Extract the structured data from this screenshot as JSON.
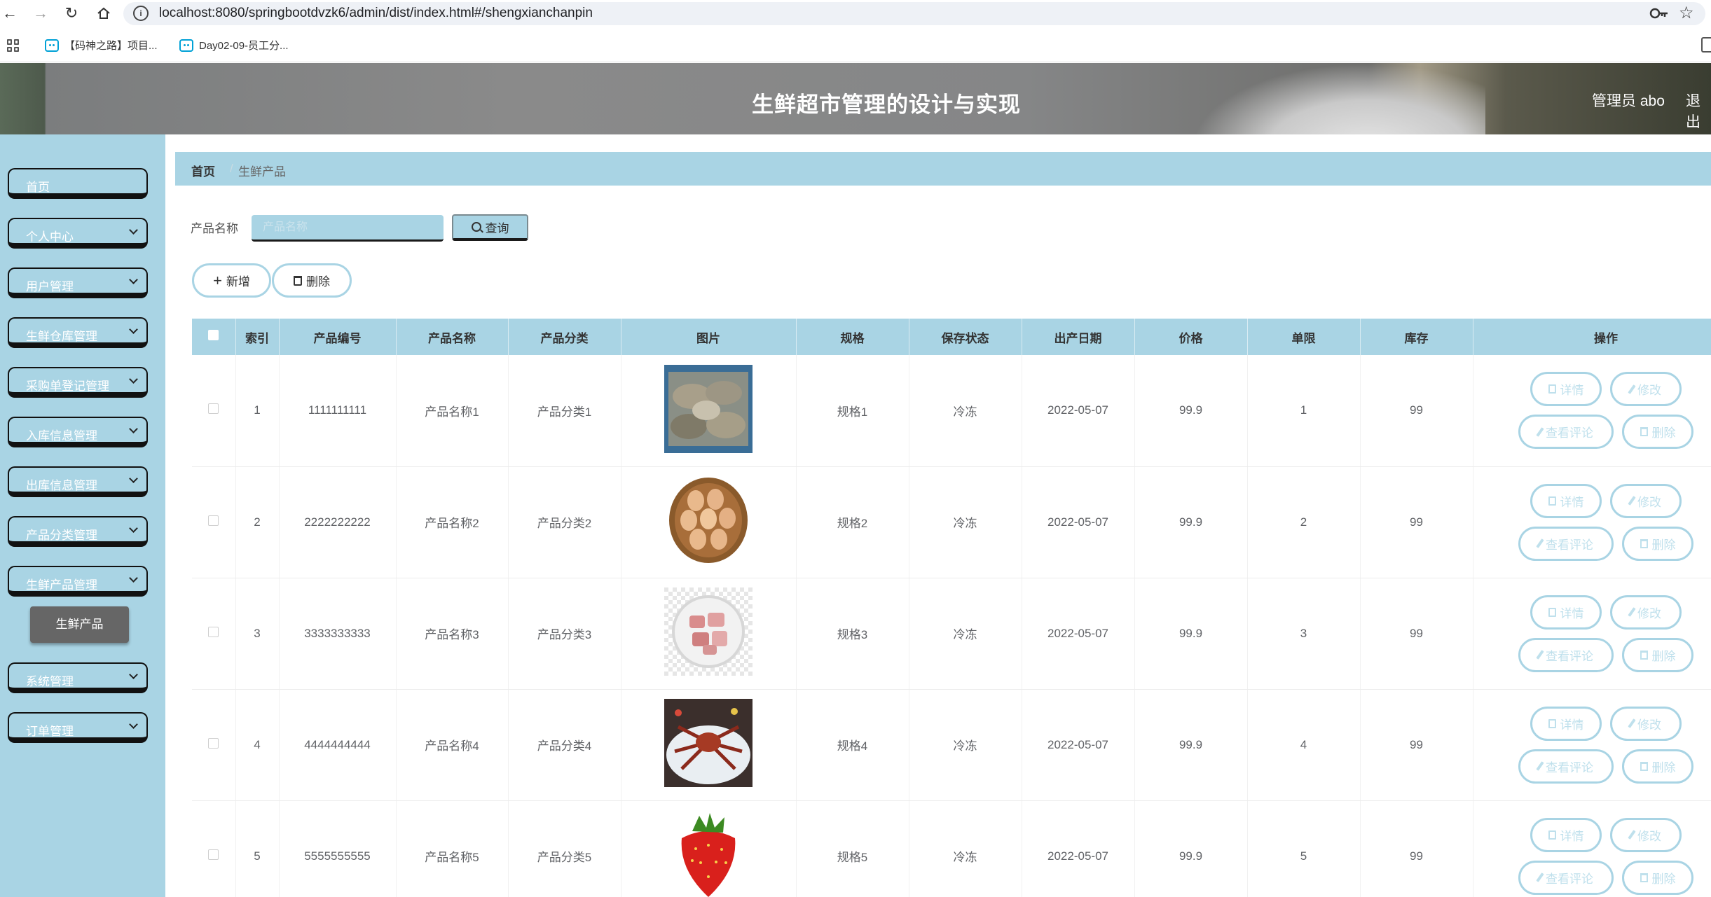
{
  "browser": {
    "url": "localhost:8080/springbootdvzk6/admin/dist/index.html#/shengxianchanpin",
    "bookmarks": [
      {
        "label": "【码神之路】项目..."
      },
      {
        "label": "Day02-09-员工分..."
      }
    ]
  },
  "header": {
    "title": "生鲜超市管理的设计与实现",
    "user_label": "管理员 abo",
    "logout_label": "退出"
  },
  "sidebar": {
    "items": [
      {
        "label": "首页",
        "has_chevron": false
      },
      {
        "label": "个人中心",
        "has_chevron": true
      },
      {
        "label": "用户管理",
        "has_chevron": true
      },
      {
        "label": "生鲜仓库管理",
        "has_chevron": true
      },
      {
        "label": "采购单登记管理",
        "has_chevron": true
      },
      {
        "label": "入库信息管理",
        "has_chevron": true
      },
      {
        "label": "出库信息管理",
        "has_chevron": true
      },
      {
        "label": "产品分类管理",
        "has_chevron": true
      },
      {
        "label": "生鲜产品管理",
        "has_chevron": true
      },
      {
        "label": "系统管理",
        "has_chevron": true
      },
      {
        "label": "订单管理",
        "has_chevron": true
      }
    ],
    "active_subitem": "生鲜产品"
  },
  "breadcrumb": {
    "home": "首页",
    "separator": "/",
    "current": "生鲜产品"
  },
  "search": {
    "label": "产品名称",
    "placeholder": "产品名称",
    "value": "",
    "button_label": "查询"
  },
  "actions": {
    "add_label": "新增",
    "delete_label": "删除"
  },
  "table": {
    "columns": [
      "",
      "索引",
      "产品编号",
      "产品名称",
      "产品分类",
      "图片",
      "规格",
      "保存状态",
      "出产日期",
      "价格",
      "单限",
      "库存",
      "操作"
    ],
    "row_actions": {
      "detail": "详情",
      "edit": "修改",
      "reviews": "查看评论",
      "delete": "删除"
    },
    "rows": [
      {
        "index": "1",
        "code": "1111111111",
        "name": "产品名称1",
        "category": "产品分类1",
        "image": "oysters",
        "spec": "规格1",
        "storage": "冷冻",
        "date": "2022-05-07",
        "price": "99.9",
        "limit": "1",
        "stock": "99"
      },
      {
        "index": "2",
        "code": "2222222222",
        "name": "产品名称2",
        "category": "产品分类2",
        "image": "eggs",
        "spec": "规格2",
        "storage": "冷冻",
        "date": "2022-05-07",
        "price": "99.9",
        "limit": "2",
        "stock": "99"
      },
      {
        "index": "3",
        "code": "3333333333",
        "name": "产品名称3",
        "category": "产品分类3",
        "image": "meat",
        "spec": "规格3",
        "storage": "冷冻",
        "date": "2022-05-07",
        "price": "99.9",
        "limit": "3",
        "stock": "99"
      },
      {
        "index": "4",
        "code": "4444444444",
        "name": "产品名称4",
        "category": "产品分类4",
        "image": "king-crab",
        "spec": "规格4",
        "storage": "冷冻",
        "date": "2022-05-07",
        "price": "99.9",
        "limit": "4",
        "stock": "99"
      },
      {
        "index": "5",
        "code": "5555555555",
        "name": "产品名称5",
        "category": "产品分类5",
        "image": "strawberry",
        "spec": "规格5",
        "storage": "冷冻",
        "date": "2022-05-07",
        "price": "99.9",
        "limit": "5",
        "stock": "99"
      }
    ]
  },
  "colors": {
    "accent": "#a9d4e4",
    "active_submenu": "#666666"
  }
}
